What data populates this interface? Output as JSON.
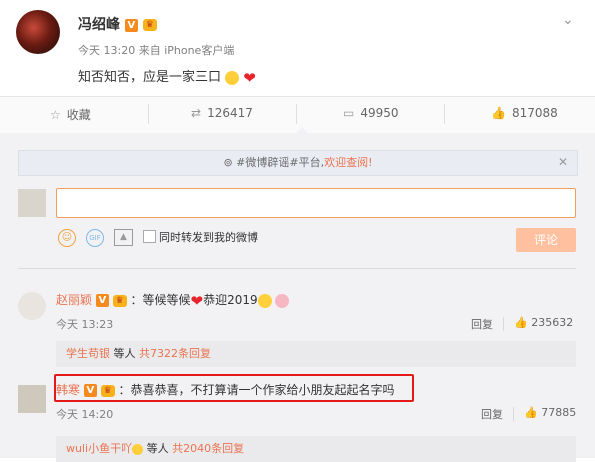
{
  "post": {
    "author": "冯绍峰",
    "v_badge": "V",
    "meta": "今天 13:20 来自 iPhone客户端",
    "text": "知否知否，应是一家三口"
  },
  "actions": {
    "favorite": "收藏",
    "repost_count": "126417",
    "comment_count": "49950",
    "like_count": "817088"
  },
  "notice": {
    "prefix": "#微博辟谣#平台,",
    "link": "欢迎查阅!"
  },
  "composer": {
    "sync_label": "同时转发到我的微博",
    "submit_label": "评论",
    "gif_label": "GIF"
  },
  "comments": [
    {
      "name": "赵丽颖",
      "text": "：等候等候",
      "text2": "恭迎2019",
      "time": "今天 13:23",
      "reply": "回复",
      "likes": "235632",
      "sub": {
        "name": "学生苟银",
        "mid": " 等人 ",
        "count": "共7322条回复"
      }
    },
    {
      "name": "韩寒",
      "text": "：恭喜恭喜，不打算请一个作家给小朋友起起名字吗",
      "time": "今天 14:20",
      "reply": "回复",
      "likes": "77885",
      "sub": {
        "name": "wuli小鱼干吖",
        "mid": " 等人 ",
        "count": "共2040条回复"
      }
    }
  ],
  "colors": {
    "accent": "#eb7350",
    "highlight": "#e41a1a",
    "submit": "#ffc09f"
  }
}
